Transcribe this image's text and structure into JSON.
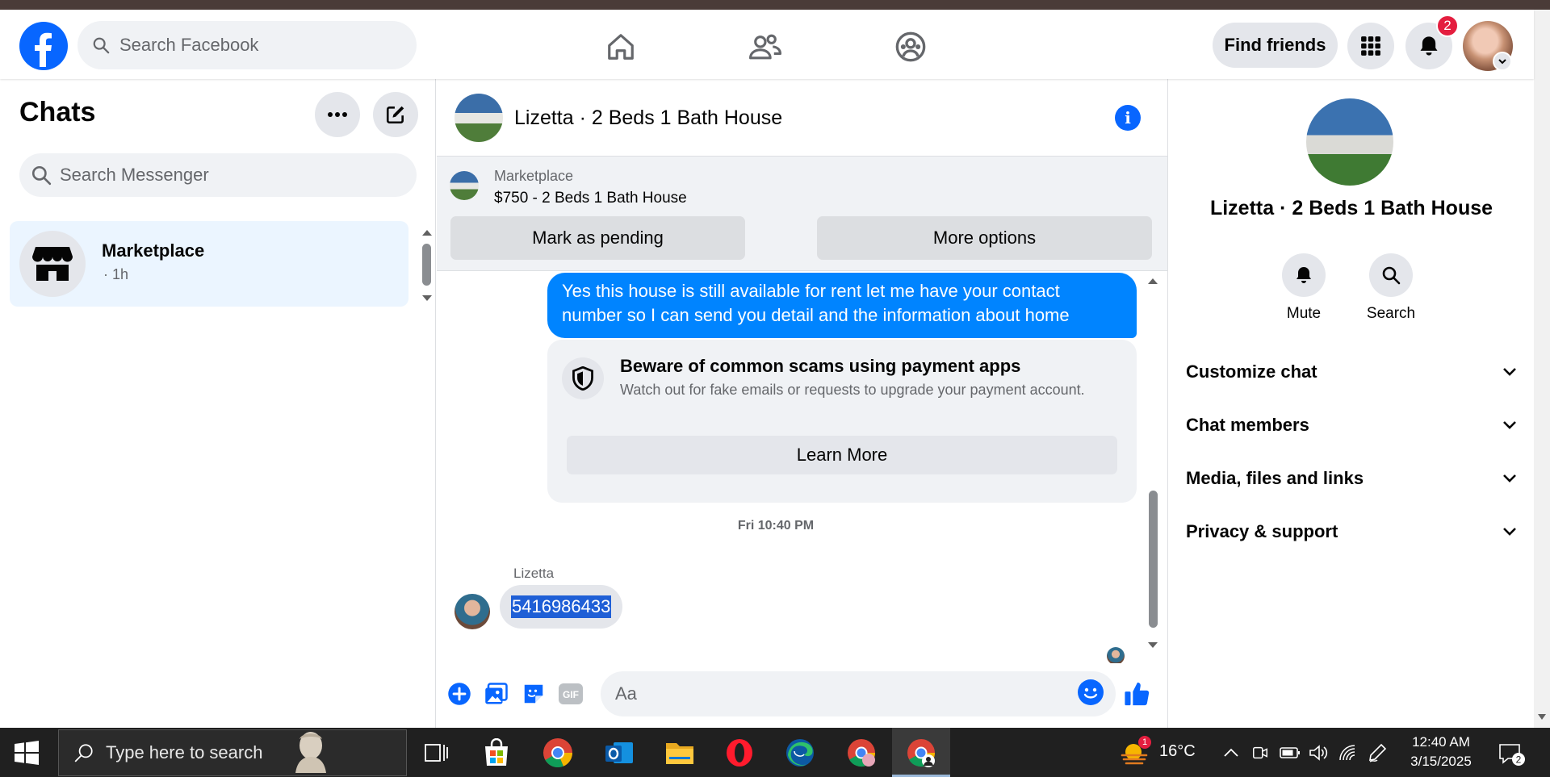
{
  "header": {
    "search_placeholder": "Search Facebook",
    "find_friends_label": "Find friends",
    "notification_count": "2"
  },
  "left": {
    "title": "Chats",
    "search_placeholder": "Search Messenger",
    "chat_item": {
      "name": "Marketplace",
      "time": "· 1h"
    }
  },
  "conversation": {
    "title": "Lizetta · 2 Beds 1 Bath House",
    "marketplace": {
      "label": "Marketplace",
      "listing": "$750 - 2 Beds 1 Bath House",
      "mark_pending": "Mark as pending",
      "more_options": "More options"
    },
    "outgoing_message": "Yes this house is still available for rent let me have your contact number so I can send you detail and the information about home",
    "scam_notice": {
      "title": "Beware of common scams using payment apps",
      "description": "Watch out for fake emails or requests to upgrade your payment account.",
      "button": "Learn More"
    },
    "timestamp": "Fri 10:40 PM",
    "sender_name": "Lizetta",
    "incoming_message": "5416986433",
    "input_placeholder": "Aa",
    "gif_label": "GIF"
  },
  "right_panel": {
    "title": "Lizetta · 2 Beds 1 Bath House",
    "mute_label": "Mute",
    "search_label": "Search",
    "sections": [
      "Customize chat",
      "Chat members",
      "Media, files and links",
      "Privacy & support"
    ]
  },
  "taskbar": {
    "search_placeholder": "Type here to search",
    "weather_badge": "1",
    "temperature": "16°C",
    "time": "12:40 AM",
    "date": "3/15/2025",
    "notification_count": "2"
  },
  "colors": {
    "brand_blue": "#0866ff",
    "bubble_blue": "#0084ff",
    "badge_red": "#e41e3f",
    "selected_chat_bg": "#ebf5ff"
  }
}
